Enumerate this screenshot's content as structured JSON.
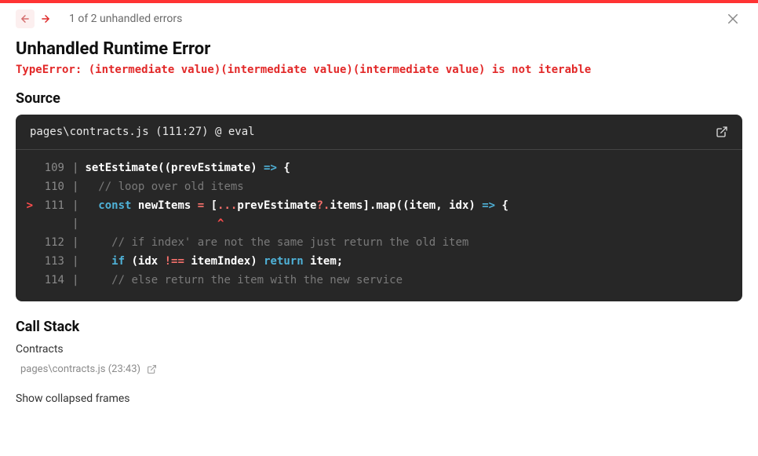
{
  "nav": {
    "count_label": "1 of 2 unhandled errors"
  },
  "error": {
    "title": "Unhandled Runtime Error",
    "message": "TypeError: (intermediate value)(intermediate value)(intermediate value) is not iterable"
  },
  "source": {
    "heading": "Source",
    "location": "pages\\contracts.js (111:27) @ eval",
    "lines": {
      "l109": {
        "num": "109"
      },
      "l110": {
        "num": "110"
      },
      "l111": {
        "num": "111",
        "marker": ">"
      },
      "caret": {
        "text": "                    ^"
      },
      "l112": {
        "num": "112"
      },
      "l113": {
        "num": "113"
      },
      "l114": {
        "num": "114"
      }
    },
    "tokens": {
      "l109_fn": "setEstimate",
      "l109_p1": "((",
      "l109_arg": "prevEstimate",
      "l109_p2": ") ",
      "l109_arrow": "=>",
      "l109_p3": " {",
      "l110_comment": "  // loop over old items",
      "l111_kw1": "  const ",
      "l111_id1": "newItems ",
      "l111_eq": "= ",
      "l111_p1": "[",
      "l111_spread": "...",
      "l111_id2": "prevEstimate",
      "l111_opt": "?.",
      "l111_prop": "items",
      "l111_p2": "].",
      "l111_fn": "map",
      "l111_p3": "((",
      "l111_arg1": "item",
      "l111_comma": ", ",
      "l111_arg2": "idx",
      "l111_p4": ") ",
      "l111_arrow": "=>",
      "l111_p5": " {",
      "l112_comment": "    // if index' are not the same just return the old item",
      "l113_kw_if": "    if ",
      "l113_p1": "(",
      "l113_id1": "idx ",
      "l113_neq": "!==",
      "l113_sp1": " ",
      "l113_id2": "itemIndex",
      "l113_p2": ") ",
      "l113_ret": "return ",
      "l113_id3": "item",
      "l113_semi": ";",
      "l114_comment": "    // else return the item with the new service"
    }
  },
  "callstack": {
    "heading": "Call Stack",
    "frames": [
      {
        "name": "Contracts",
        "location": "pages\\contracts.js (23:43)"
      }
    ],
    "show_collapsed": "Show collapsed frames"
  }
}
